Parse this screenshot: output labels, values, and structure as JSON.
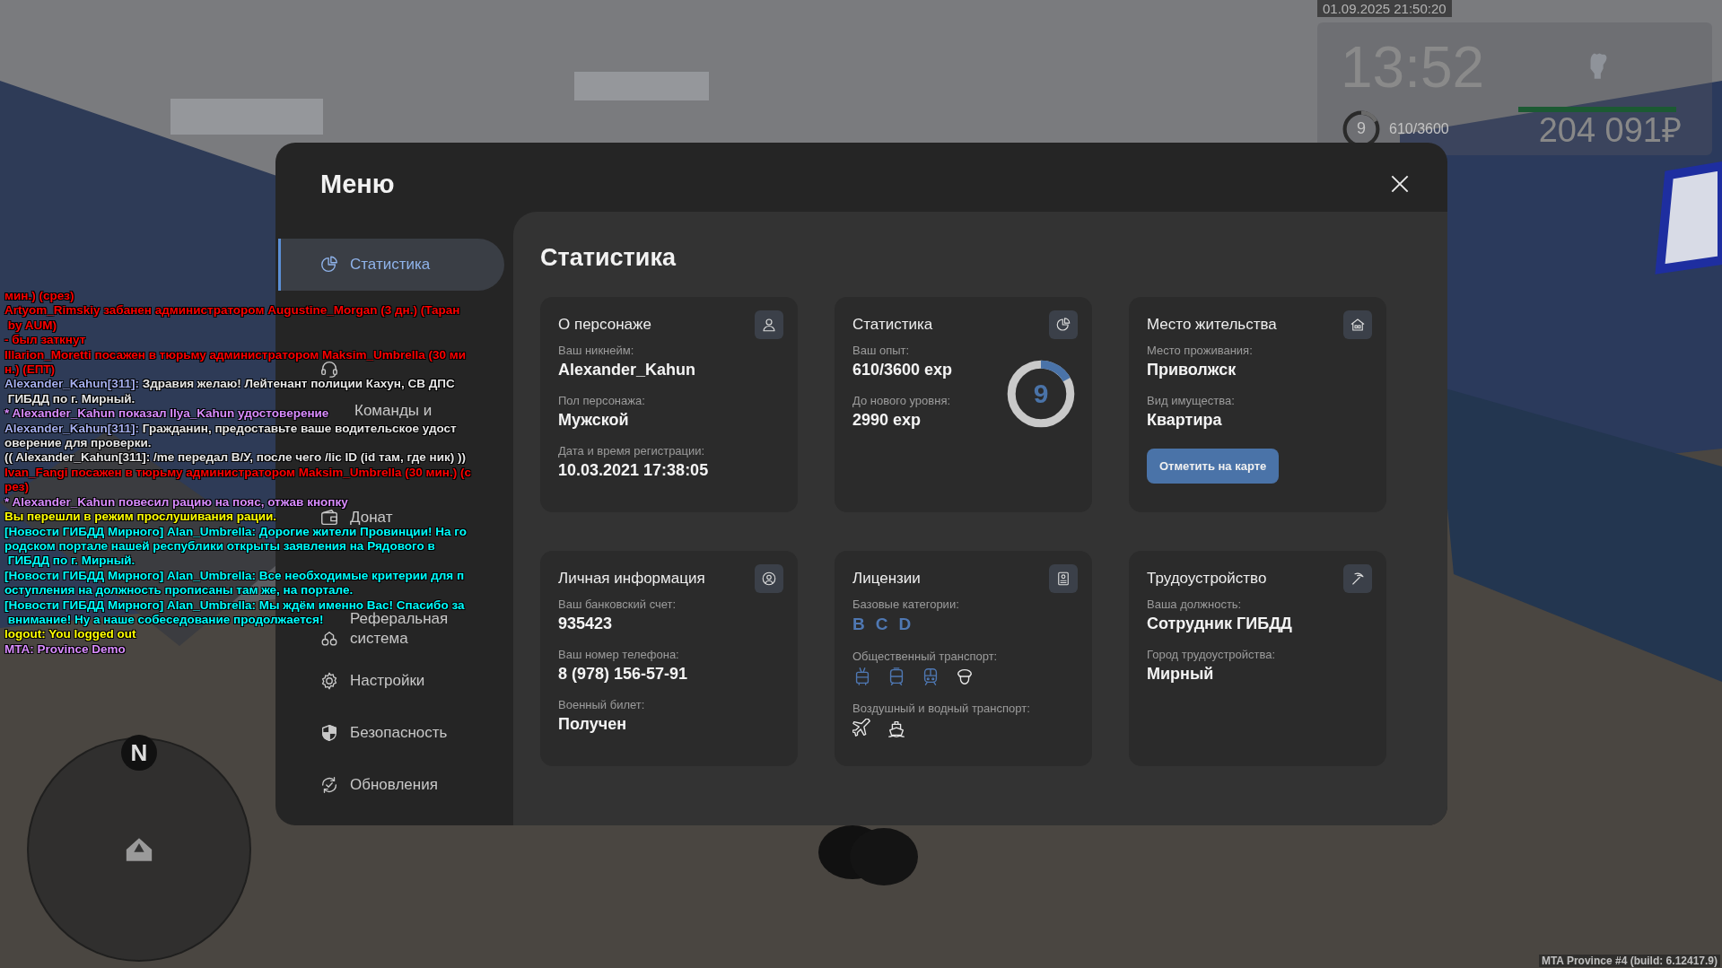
{
  "hud": {
    "datetime": "01.09.2025 21:50:20",
    "clock": "13:52",
    "level_number": "9",
    "level": 0.169,
    "experience": "610/3600",
    "money": "204 091₽"
  },
  "menu": {
    "title": "Меню",
    "sidebar": [
      {
        "kind": "stats",
        "label": "Статистика",
        "selected": true
      },
      {
        "selected": false
      },
      {
        "kind": "support",
        "selected": false
      },
      {
        "label": "Команды и",
        "selected": false
      },
      {
        "selected": false
      },
      {
        "kind": "donate",
        "label": "Донат",
        "selected": false
      },
      {
        "selected": false
      },
      {
        "kind": "referral",
        "label": "Реферальная система",
        "selected": false
      },
      {
        "kind": "settings",
        "label": "Настройки",
        "selected": false
      },
      {
        "kind": "security",
        "label": "Безопасность",
        "selected": false
      },
      {
        "kind": "updates",
        "label": "Обновления",
        "selected": false
      }
    ],
    "content": {
      "title": "Статистика",
      "cards": [
        {
          "kind": "character",
          "title": "О персонаже",
          "fields": [
            {
              "label": "Ваш никнейм:",
              "value": "Alexander_Kahun"
            },
            {
              "label": "Пол персонажа:",
              "value": "Мужской"
            },
            {
              "label": "Дата и время регистрации:",
              "value": "10.03.2021 17:38:05"
            }
          ]
        },
        {
          "kind": "stats",
          "title": "Статистика",
          "fields": [
            {
              "label": "Ваш опыт:",
              "value": "610/3600 exp"
            },
            {
              "label": "До нового уровня:",
              "value": "2990 exp"
            }
          ],
          "level": 0.169,
          "level_number": "9"
        },
        {
          "kind": "residence",
          "title": "Место жительства",
          "fields": [
            {
              "label": "Место проживания:",
              "value": "Приволжск"
            },
            {
              "label": "Вид имущества:",
              "value": "Квартира"
            }
          ],
          "button": "Отметить на карте"
        },
        {
          "kind": "personal",
          "title": "Личная информация",
          "fields": [
            {
              "label": "Ваш банковский счет:",
              "value": "935423"
            },
            {
              "label": "Ваш номер телефона:",
              "value": "8 (978) 156-57-91"
            },
            {
              "label": "Военный билет:",
              "value": "Получен"
            }
          ]
        },
        {
          "kind": "licenses",
          "title": "Лицензии",
          "groups": [
            {
              "label": "Базовые категории:",
              "kind": "letters",
              "items": [
                {
                  "text": "B",
                  "held": true
                },
                {
                  "text": "C",
                  "held": true
                },
                {
                  "text": "D",
                  "held": true
                }
              ]
            },
            {
              "label": "Общественный транспорт:",
              "kind": "icons",
              "items": [
                {
                  "kind": "trolleybus",
                  "held": true
                },
                {
                  "kind": "tram",
                  "held": true
                },
                {
                  "kind": "train",
                  "held": true
                },
                {
                  "kind": "cap",
                  "held": false
                }
              ]
            },
            {
              "label": "Воздушный и водный транспорт:",
              "kind": "icons",
              "items": [
                {
                  "kind": "plane",
                  "held": false
                },
                {
                  "kind": "ship",
                  "held": false
                }
              ]
            }
          ]
        },
        {
          "kind": "job",
          "title": "Трудоустройство",
          "fields": [
            {
              "label": "Ваша должность:",
              "value": "Сотрудник ГИБДД"
            },
            {
              "label": "Город трудоустройства:",
              "value": "Мирный"
            }
          ]
        }
      ]
    }
  },
  "chat": [
    {
      "parts": [
        {
          "text": "мин.) (срез)",
          "color": "#ff0000"
        }
      ]
    },
    {
      "parts": [
        {
          "text": "Artyom_Rimskiy забанен администратором Augustine_Morgan (3 дн.) (Таран",
          "color": "#ff0000"
        }
      ]
    },
    {
      "parts": [
        {
          "text": " by AUM)",
          "color": "#ff0000"
        }
      ]
    },
    {
      "parts": [
        {
          "text": "- был заткнут",
          "color": "#ff0000"
        }
      ]
    },
    {
      "parts": [
        {
          "text": "Illarion_Moretti посажен в тюрьму администратором Maksim_Umbrella (30 ми",
          "color": "#ff0000"
        }
      ]
    },
    {
      "parts": [
        {
          "text": "н.) (ЕПТ)",
          "color": "#ff0000"
        }
      ]
    },
    {
      "parts": [
        {
          "text": "Alexander_Kahun[311]: ",
          "color": "#a6b0f0"
        },
        {
          "text": "Здравия желаю! Лейтенант полиции Кахун, СВ ДПС",
          "color": "#e6e6e6"
        }
      ]
    },
    {
      "parts": [
        {
          "text": " ГИБДД по г. Мирный.",
          "color": "#e6e6e6"
        }
      ]
    },
    {
      "parts": [
        {
          "text": "* Alexander_Kahun показал Ilya_Kahun удостоверение",
          "color": "#d98cff"
        }
      ]
    },
    {
      "parts": [
        {
          "text": "Alexander_Kahun[311]: ",
          "color": "#a6b0f0"
        },
        {
          "text": "Гражданин, предоставьте ваше водительское удост",
          "color": "#e6e6e6"
        }
      ]
    },
    {
      "parts": [
        {
          "text": "оверение для проверки.",
          "color": "#e6e6e6"
        }
      ]
    },
    {
      "parts": [
        {
          "text": "(( Alexander_Kahun[311]: /me передал В/У, после чего /lic ID (id там, где ник) ))",
          "color": "#e6e6e6"
        }
      ]
    },
    {
      "parts": [
        {
          "text": "Ivan_Fangi посажен в тюрьму администратором Maksim_Umbrella (30 мин.) (с",
          "color": "#ff0000"
        }
      ]
    },
    {
      "parts": [
        {
          "text": "рез)",
          "color": "#ff0000"
        }
      ]
    },
    {
      "parts": [
        {
          "text": "* Alexander_Kahun повесил рацию на пояс, отжав кнопку",
          "color": "#d98cff"
        }
      ]
    },
    {
      "parts": [
        {
          "text": "Вы перешли в режим прослушивания рации.",
          "color": "#ffff00"
        }
      ]
    },
    {
      "parts": [
        {
          "text": "[Новости ГИБДД Мирного] Alan_Umbrella: Дорогие жители Провинции! На го",
          "color": "#00ffff"
        }
      ]
    },
    {
      "parts": [
        {
          "text": "родском портале нашей республики открыты заявления на Рядового в",
          "color": "#00ffff"
        }
      ]
    },
    {
      "parts": [
        {
          "text": " ГИБДД по г. Мирный.",
          "color": "#00ffff"
        }
      ]
    },
    {
      "parts": [
        {
          "text": "[Новости ГИБДД Мирного] Alan_Umbrella: Все необходимые критерии для п",
          "color": "#00ffff"
        }
      ]
    },
    {
      "parts": [
        {
          "text": "оступления на должность прописаны там же, на портале.",
          "color": "#00ffff"
        }
      ]
    },
    {
      "parts": [
        {
          "text": "[Новости ГИБДД Мирного] Alan_Umbrella: Мы ждём именно Вас! Спасибо за",
          "color": "#00ffff"
        }
      ]
    },
    {
      "parts": [
        {
          "text": " внимание! Ну а наше собеседование продолжается!",
          "color": "#00ffff"
        }
      ]
    },
    {
      "parts": [
        {
          "text": "logout: You logged out",
          "color": "#ffff00"
        }
      ]
    },
    {
      "parts": [
        {
          "text": "MTA: Province Demo",
          "color": "#d98cff"
        }
      ]
    }
  ],
  "compass": {
    "north_label": "N"
  },
  "version": "MTA Province #4 (build: 6.12417.9)"
}
